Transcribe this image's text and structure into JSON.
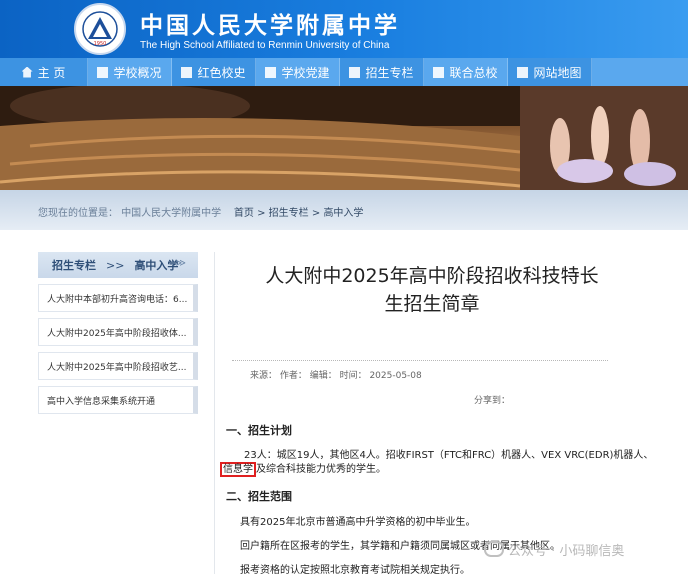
{
  "header": {
    "title_cn": "中国人民大学附属中学",
    "title_en": "The High School Affiliated to Renmin University of China",
    "logo_text": "1950"
  },
  "nav": [
    {
      "label": "主 页"
    },
    {
      "label": "学校概况"
    },
    {
      "label": "红色校史"
    },
    {
      "label": "学校党建"
    },
    {
      "label": "招生专栏"
    },
    {
      "label": "联合总校"
    },
    {
      "label": "网站地图"
    }
  ],
  "breadcrumb": {
    "prefix": "您现在的位置是：",
    "site": "中国人民大学附属中学",
    "items": [
      "首页",
      "招生专栏",
      "高中入学"
    ],
    "sep": ">"
  },
  "sidebar": {
    "head_section": "招生专栏",
    "head_sep": ">>",
    "head_current": "高中入学",
    "chevron": "≫",
    "items": [
      {
        "label": "人大附中本部初升高咨询电话：6..."
      },
      {
        "label": "人大附中2025年高中阶段招收体..."
      },
      {
        "label": "人大附中2025年高中阶段招收艺..."
      },
      {
        "label": "高中入学信息采集系统开通"
      }
    ]
  },
  "article": {
    "title_line1": "人大附中2025年高中阶段招收科技特长",
    "title_line2": "生招生简章",
    "meta": "来源：   作者：   编辑：   时间：   2025-05-08",
    "share": "分享到：",
    "section1": "一、招生计划",
    "p1_line1": "23人：城区19人，其他区4人。招收FIRST（FTC和FRC）机器人、VEX VRC(EDR)机器人、",
    "p1_highlight": "信息学",
    "p1_line2_rest": "及综合科技能力优秀的学生。",
    "section2": "二、招生范围",
    "p2": "具有2025年北京市普通高中升学资格的初中毕业生。",
    "p3": "回户籍所在区报考的学生，其学籍和户籍须同属城区或者同属于其他区。",
    "p4": "报考资格的认定按照北京教育考试院相关规定执行。"
  },
  "watermark": "公众号 · 小码聊信奥",
  "colors": {
    "header": "#1a7fe0",
    "nav": "#3d93e2",
    "highlight_border": "#e02020"
  }
}
